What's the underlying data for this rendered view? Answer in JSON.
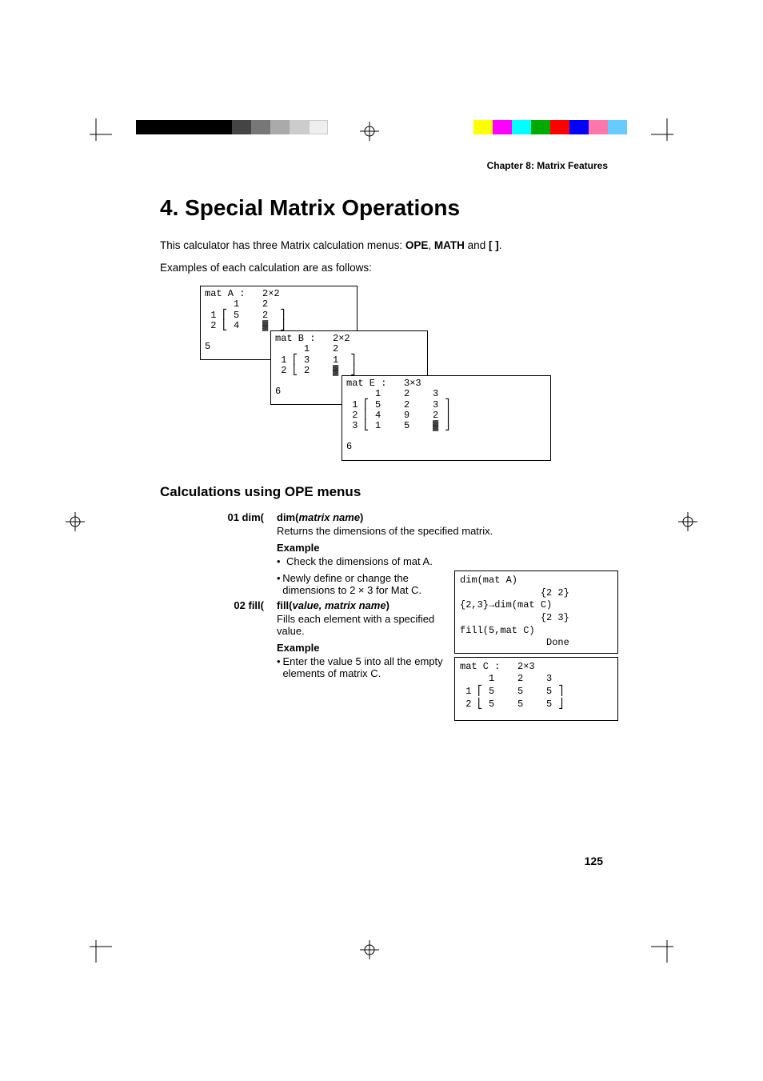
{
  "header": {
    "chapter": "Chapter 8: Matrix Features"
  },
  "title": "4. Special Matrix Operations",
  "intro1_a": "This calculator has three Matrix calculation menus: ",
  "intro1_b": "OPE",
  "intro1_c": ", ",
  "intro1_d": "MATH",
  "intro1_e": " and ",
  "intro1_f": "[ ]",
  "intro1_g": ".",
  "intro2": "Examples of each calculation are as follows:",
  "screens": {
    "A": "mat A :   2×2\n     1    2\n 1 ⎡ 5    2  ⎤\n 2 ⎣ 4    ▓  ⎦\n\n5",
    "B": "mat B :   2×2\n     1    2\n 1 ⎡ 3    1  ⎤\n 2 ⎣ 2    ▓  ⎦\n\n6",
    "E": "mat E :   3×3\n     1    2    3\n 1 ⎡ 5    2    3 ⎤\n 2 ⎢ 4    9    2 ⎥\n 3 ⎣ 1    5    ▓ ⎦\n\n6"
  },
  "subhead": "Calculations using OPE menus",
  "ops": {
    "dim": {
      "label": "01 dim(",
      "sig_a": "dim(",
      "sig_b": "matrix name",
      "sig_c": ")",
      "desc": "Returns the dimensions of the specified matrix.",
      "ex_head": "Example",
      "b1": "Check the dimensions of mat A.",
      "b2": "Newly define or change the dimensions to 2 × 3 for Mat C."
    },
    "fill": {
      "label": "02 fill(",
      "sig_a": "fill(",
      "sig_b": "value, matrix name",
      "sig_c": ")",
      "desc": "Fills each element with a specified value.",
      "ex_head": "Example",
      "b1": "Enter the value 5 into all the empty elements of matrix C."
    }
  },
  "side_screens": {
    "calc": "dim(mat A)\n              {2 2}\n{2,3}→dim(mat C)\n              {2 3}\nfill(5,mat C)\n               Done",
    "matC": "mat C :   2×3\n     1    2    3\n 1 ⎡ 5    5    5 ⎤\n 2 ⎣ 5    5    5 ⎦"
  },
  "page_number": "125",
  "colors_left": [
    "#000",
    "#000",
    "#000",
    "#000",
    "#000",
    "#333",
    "#555",
    "#777",
    "#999",
    "#bbb",
    "#ddd",
    "#fff"
  ],
  "colors_right": [
    "#ff0",
    "#f0f",
    "#0ff",
    "#0a0",
    "#f00",
    "#00f",
    "#f7a",
    "#6cf"
  ]
}
